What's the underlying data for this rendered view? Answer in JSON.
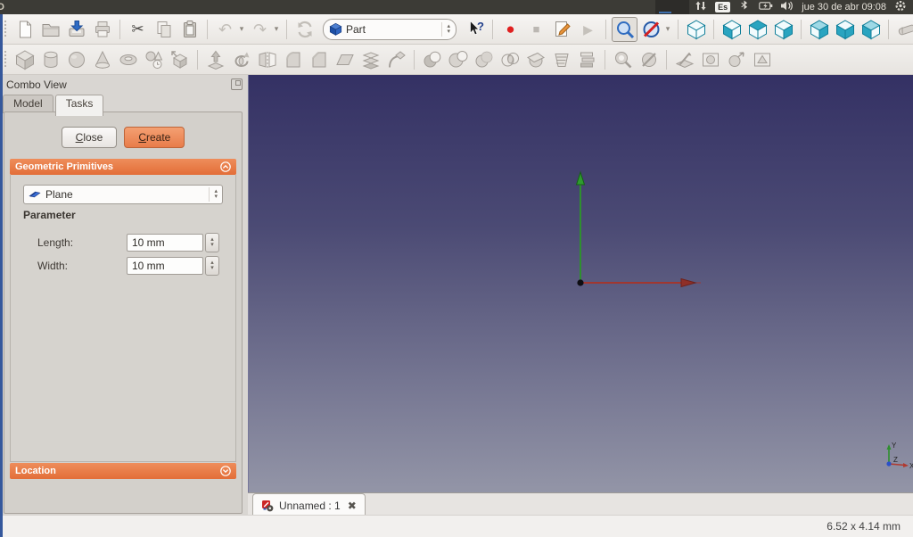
{
  "system_bar": {
    "window_title": "D",
    "clock": "jue 30 de abr 09:08",
    "tray": [
      {
        "name": "network-updown-icon",
        "kind": "updown"
      },
      {
        "name": "keyboard-layout-indicator",
        "kind": "badge",
        "label": "Es"
      },
      {
        "name": "bluetooth-icon",
        "kind": "bluetooth"
      },
      {
        "name": "battery-icon",
        "kind": "battery"
      },
      {
        "name": "volume-icon",
        "kind": "volume"
      },
      {
        "name": "clock-label",
        "kind": "text"
      },
      {
        "name": "session-gear-icon",
        "kind": "gear"
      }
    ]
  },
  "ui_glyphs": {
    "up": "▴",
    "down": "▾",
    "close": "✖"
  },
  "toolbar_main": {
    "workbench_selector": {
      "value": "Part"
    },
    "items": [
      {
        "kind": "handle"
      },
      {
        "name": "new-document-button",
        "kind": "page",
        "enabled": true
      },
      {
        "name": "open-document-button",
        "kind": "folder",
        "enabled": true
      },
      {
        "name": "save-button",
        "kind": "save",
        "enabled": true
      },
      {
        "name": "print-button",
        "kind": "print",
        "enabled": false
      },
      {
        "kind": "sep"
      },
      {
        "name": "cut-button",
        "kind": "scissors",
        "enabled": true
      },
      {
        "name": "copy-button",
        "kind": "copy",
        "enabled": false
      },
      {
        "name": "paste-button",
        "kind": "paste",
        "enabled": true
      },
      {
        "kind": "sep"
      },
      {
        "name": "undo-button",
        "kind": "undo",
        "enabled": false,
        "dropdown": true
      },
      {
        "name": "redo-button",
        "kind": "redo",
        "enabled": false,
        "dropdown": true
      },
      {
        "kind": "sep"
      },
      {
        "name": "refresh-button",
        "kind": "refresh",
        "enabled": false
      },
      {
        "name": "workbench-selector",
        "kind": "combobox"
      },
      {
        "name": "whats-this-button",
        "kind": "helpcursor",
        "enabled": true
      },
      {
        "kind": "sep"
      },
      {
        "name": "macro-record-button",
        "kind": "record",
        "enabled": true
      },
      {
        "name": "macro-stop-button",
        "kind": "stop",
        "enabled": false
      },
      {
        "name": "macro-edit-button",
        "kind": "macro",
        "enabled": true
      },
      {
        "name": "macro-play-button",
        "kind": "play",
        "enabled": false
      },
      {
        "kind": "sep"
      },
      {
        "name": "fit-all-button",
        "kind": "zoomfit",
        "enabled": true,
        "boxed": true
      },
      {
        "name": "draw-style-button",
        "kind": "drawstyle",
        "enabled": true,
        "dropdown": true
      },
      {
        "kind": "sep"
      },
      {
        "name": "axonometric-view-button",
        "kind": "cube",
        "variant": "axo",
        "enabled": true
      },
      {
        "kind": "sep"
      },
      {
        "name": "front-view-button",
        "kind": "cube",
        "variant": "front",
        "enabled": true
      },
      {
        "name": "top-view-button",
        "kind": "cube",
        "variant": "top",
        "enabled": true
      },
      {
        "name": "right-view-button",
        "kind": "cube",
        "variant": "right",
        "enabled": true
      },
      {
        "kind": "sep"
      },
      {
        "name": "rear-view-button",
        "kind": "cube",
        "variant": "rear",
        "enabled": true
      },
      {
        "name": "bottom-view-button",
        "kind": "cube",
        "variant": "bottom",
        "enabled": true
      },
      {
        "name": "left-view-button",
        "kind": "cube",
        "variant": "left",
        "enabled": true
      },
      {
        "kind": "sep"
      },
      {
        "name": "measure-button",
        "kind": "eraser",
        "enabled": false
      }
    ]
  },
  "toolbar_part": {
    "items": [
      {
        "kind": "handle"
      },
      {
        "name": "part-box-button",
        "kind": "gbox",
        "enabled": false
      },
      {
        "name": "part-cylinder-button",
        "kind": "gcyl",
        "enabled": false
      },
      {
        "name": "part-sphere-button",
        "kind": "gsphere",
        "enabled": false
      },
      {
        "name": "part-cone-button",
        "kind": "gcone",
        "enabled": false
      },
      {
        "name": "part-torus-button",
        "kind": "gtorus",
        "enabled": false
      },
      {
        "name": "part-create-primitives-button",
        "kind": "gmulti",
        "enabled": false
      },
      {
        "name": "part-shape-builder-button",
        "kind": "gbuilder",
        "enabled": false
      },
      {
        "kind": "sep"
      },
      {
        "name": "part-extrude-button",
        "kind": "gextrude",
        "enabled": false
      },
      {
        "name": "part-revolve-button",
        "kind": "grevolve",
        "enabled": false
      },
      {
        "name": "part-mirror-button",
        "kind": "gmirror",
        "enabled": false
      },
      {
        "name": "part-fillet-button",
        "kind": "gfillet",
        "enabled": false
      },
      {
        "name": "part-chamfer-button",
        "kind": "gchamfer",
        "enabled": false
      },
      {
        "name": "part-make-face-button",
        "kind": "gface",
        "enabled": false
      },
      {
        "name": "part-loft-button",
        "kind": "gloft",
        "enabled": false
      },
      {
        "name": "part-sweep-button",
        "kind": "gsweep",
        "enabled": false
      },
      {
        "kind": "sep"
      },
      {
        "name": "part-boolean-button",
        "kind": "gbool",
        "enabled": false
      },
      {
        "name": "part-cut-button",
        "kind": "gcut",
        "enabled": false
      },
      {
        "name": "part-union-button",
        "kind": "gunion",
        "enabled": false
      },
      {
        "name": "part-intersection-button",
        "kind": "gcommon",
        "enabled": false
      },
      {
        "name": "part-section-button",
        "kind": "gsection",
        "enabled": false
      },
      {
        "name": "part-cross-sections-button",
        "kind": "gxsec",
        "enabled": false
      },
      {
        "name": "part-compound-button",
        "kind": "gcompound",
        "enabled": false
      },
      {
        "kind": "sep"
      },
      {
        "name": "part-check-geometry-button",
        "kind": "gcheck",
        "enabled": false
      },
      {
        "name": "part-defeaturing-button",
        "kind": "gdefeat",
        "enabled": false
      },
      {
        "kind": "sep"
      },
      {
        "name": "part-refine-shape-button",
        "kind": "gslash",
        "enabled": false
      },
      {
        "name": "part-offset-button",
        "kind": "gboxed",
        "enabled": false
      },
      {
        "name": "part-thickness-button",
        "kind": "gspherearrow",
        "enabled": false
      },
      {
        "name": "part-convert-button",
        "kind": "gboxed2",
        "enabled": false
      }
    ]
  },
  "combo_view": {
    "title": "Combo View",
    "tabs": [
      {
        "label": "Model",
        "active": false
      },
      {
        "label": "Tasks",
        "active": true
      }
    ],
    "close_button": {
      "mnemonic": "C",
      "rest": "lose"
    },
    "create_button": {
      "mnemonic": "C",
      "rest": "reate"
    },
    "geometric_primitives": {
      "title": "Geometric Primitives",
      "primitive_selector_value": "Plane",
      "parameter_label": "Parameter",
      "fields": [
        {
          "label": "Length:",
          "value": "10 mm"
        },
        {
          "label": "Width:",
          "value": "10 mm"
        }
      ]
    },
    "location": {
      "title": "Location"
    }
  },
  "viewport": {
    "axis_labels": {
      "x": "X",
      "y": "Y",
      "z": "Z"
    },
    "background_top": "#343164",
    "background_bottom": "#9395a7",
    "axis_colors": {
      "x": "#a03730",
      "y": "#2f8f2f",
      "z": "#2b50c8"
    }
  },
  "document_tab": {
    "label": "Unnamed : 1"
  },
  "status_bar": {
    "dimensions": "6.52 x 4.14 mm"
  }
}
